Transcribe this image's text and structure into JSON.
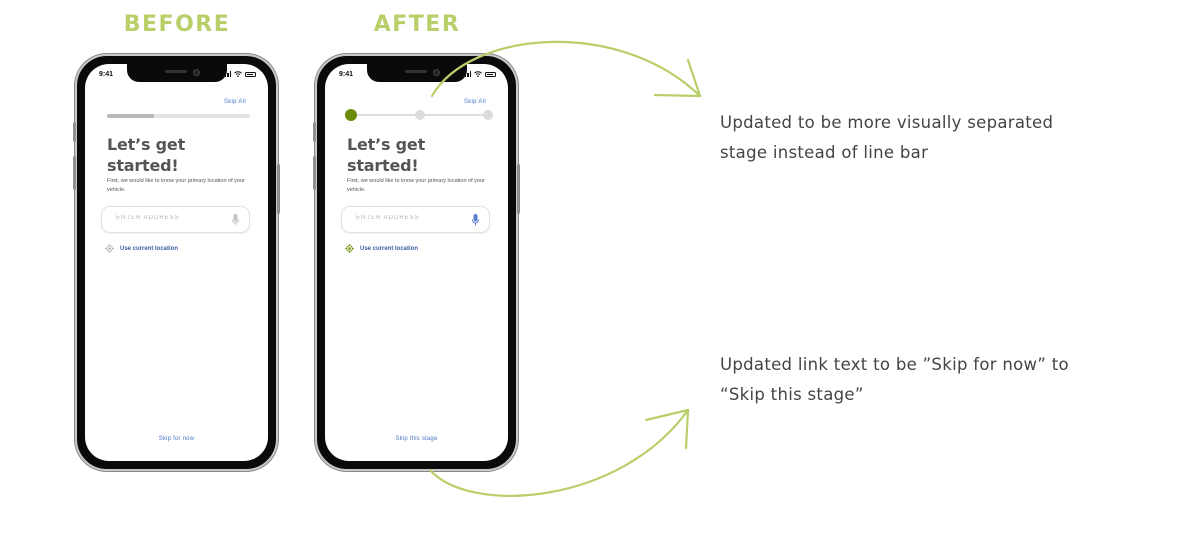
{
  "headings": {
    "before": "BEFORE",
    "after": "AFTER"
  },
  "phones": {
    "before": {
      "time": "9:41",
      "skip_all": "Skip All",
      "progress": {
        "type": "bar",
        "fraction": 0.33
      },
      "title": "Let’s get started!",
      "subtitle": "First, we would like to know your primary location of your vehicle.",
      "address_placeholder": "ENTER ADDRESS",
      "location_link": "Use current location",
      "location_icon_color": "#b5b5b5",
      "skip_link": "Skip for now"
    },
    "after": {
      "time": "9:41",
      "skip_all": "Skip All",
      "progress": {
        "type": "stages",
        "stages": 3,
        "current": 1
      },
      "title": "Let’s get started!",
      "subtitle": "First, we would like to know your primary location of your vehicle.",
      "address_placeholder": "ENTER ADDRESS",
      "location_link": "Use current location",
      "location_icon_color": "#7a9a14",
      "skip_link": "Skip this stage"
    }
  },
  "annotations": [
    {
      "text": "Updated to be more visually separated stage instead of line bar"
    },
    {
      "text": "Updated link text to be ”Skip for now” to “Skip this stage”"
    }
  ],
  "colors": {
    "accent_green": "#b8cf6a",
    "stage_active": "#6b8c0a",
    "link_blue": "#4a77c9",
    "mic_before": "#c4c4c4",
    "mic_after": "#5a7fd0"
  },
  "icons": [
    "signal-icon",
    "wifi-icon",
    "battery-icon",
    "microphone-icon",
    "location-target-icon",
    "curved-arrow-icon"
  ]
}
